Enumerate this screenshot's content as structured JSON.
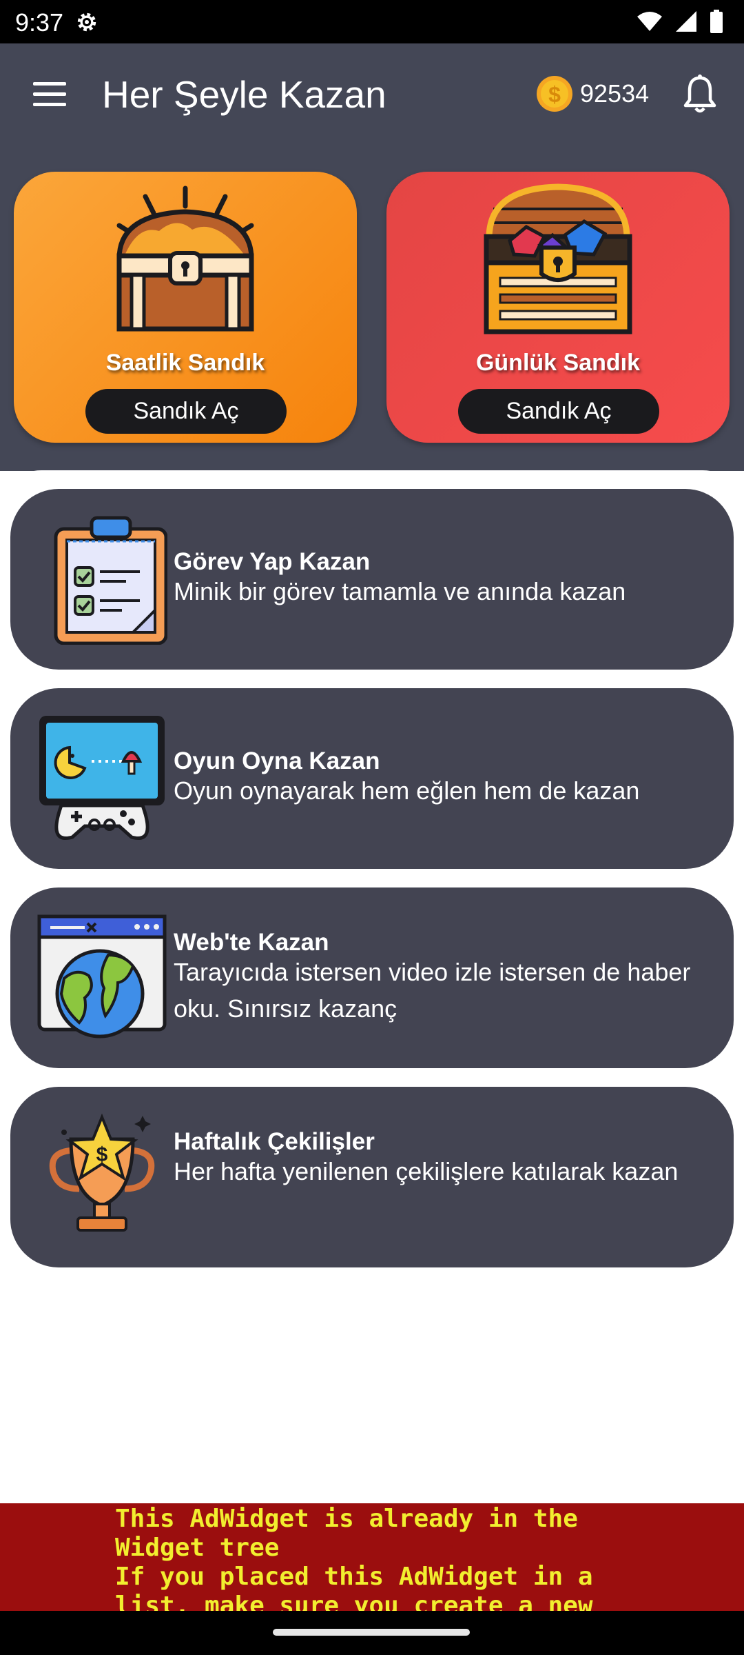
{
  "status_bar": {
    "time": "9:37"
  },
  "app_bar": {
    "title": "Her Şeyle Kazan",
    "coin_amount": "92534"
  },
  "chests": [
    {
      "label": "Saatlik Sandık",
      "button": "Sandık Aç"
    },
    {
      "label": "Günlük Sandık",
      "button": "Sandık Aç"
    }
  ],
  "tasks": [
    {
      "title": "Görev Yap Kazan",
      "description": "Minik bir görev tamamla ve anında kazan",
      "icon": "clipboard-checklist-icon"
    },
    {
      "title": "Oyun Oyna Kazan",
      "description": "Oyun oynayarak hem eğlen hem de kazan",
      "icon": "gamepad-monitor-icon"
    },
    {
      "title": "Web'te Kazan",
      "description": "Tarayıcıda istersen video izle istersen de haber oku. Sınırsız kazanç",
      "icon": "browser-globe-icon"
    },
    {
      "title": "Haftalık Çekilişler",
      "description": "Her hafta yenilenen çekilişlere katılarak kazan",
      "icon": "trophy-icon"
    }
  ],
  "ad_error": {
    "text": "This AdWidget is already in the\nWidget tree\nIf you placed this AdWidget in a\nlist, make sure you create a new"
  },
  "colors": {
    "header_bg": "#444756",
    "card_bg": "#434452",
    "chest_hourly": "#f6830c",
    "chest_daily": "#f64c4c",
    "error_bg": "#9b0e0e",
    "error_text": "#f2ee2f"
  }
}
